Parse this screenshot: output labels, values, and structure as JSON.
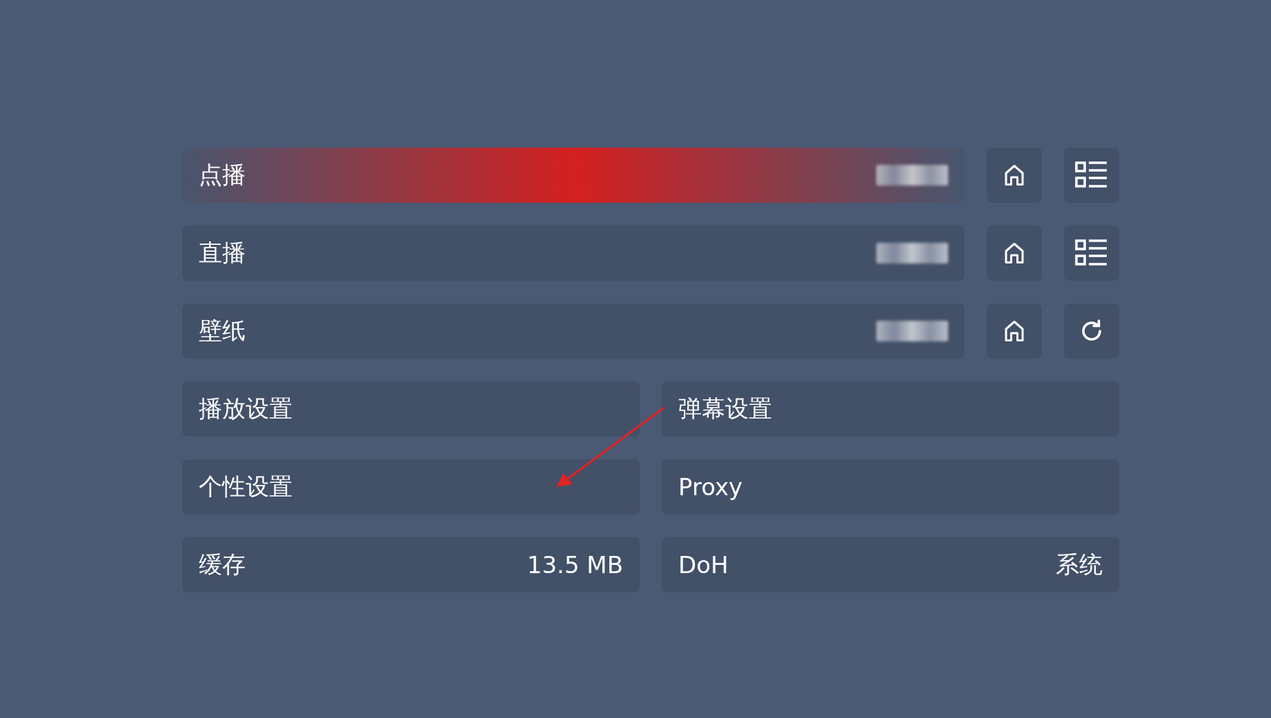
{
  "source_rows": [
    {
      "kind": "vod",
      "label": "点播",
      "selected": true
    },
    {
      "kind": "live",
      "label": "直播",
      "selected": false
    },
    {
      "kind": "wallpaper",
      "label": "壁纸",
      "selected": false
    }
  ],
  "setting_rows": [
    [
      {
        "label": "播放设置",
        "selected": false
      },
      {
        "label": "弹幕设置",
        "selected": false
      }
    ],
    [
      {
        "label": "个性设置",
        "selected": false
      },
      {
        "label": "Proxy",
        "selected": false
      }
    ],
    [
      {
        "label": "缓存",
        "value": "13.5 MB",
        "selected": false
      },
      {
        "label": "DoH",
        "value": "系统",
        "selected": false
      }
    ]
  ]
}
